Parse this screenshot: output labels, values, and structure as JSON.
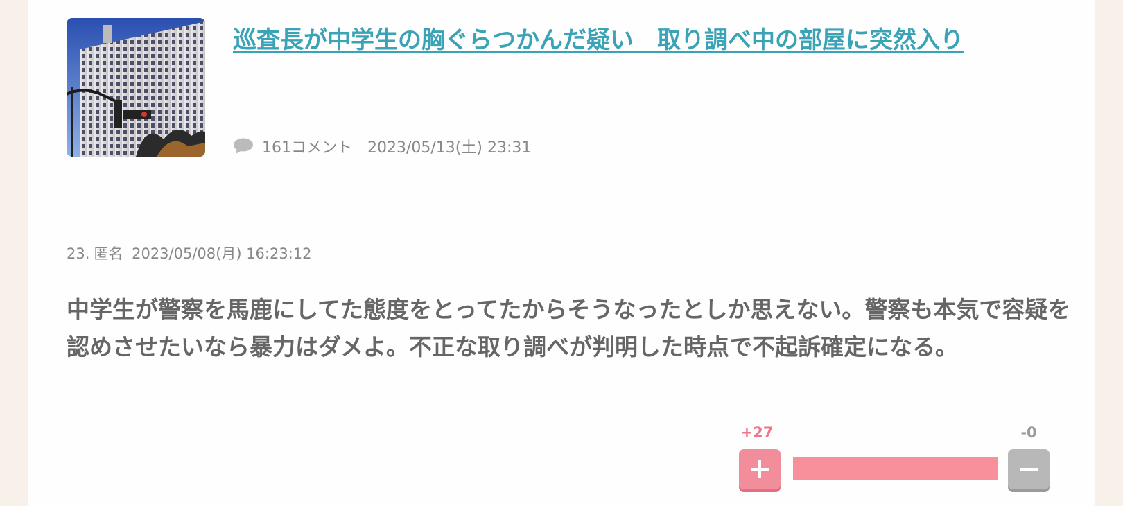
{
  "article": {
    "title": "巡査長が中学生の胸ぐらつかんだ疑い　取り調べ中の部屋に突然入り",
    "comment_icon": "speech-bubble-icon",
    "comment_count": "161コメント",
    "date": "2023/05/13(土) 23:31"
  },
  "comment": {
    "number": "23.",
    "author": "匿名",
    "timestamp": "2023/05/08(月) 16:23:12",
    "body": "中学生が警察を馬鹿にしてた態度をとってたからそうなったとしか思えない。警察も本気で容疑を認めさせたいなら暴力はダメよ。不正な取り調べが判明した時点で不起訴確定になる。",
    "vote": {
      "plus_label": "+27",
      "minus_label": "-0",
      "plus_share": 1.0,
      "plus_icon": "plus-icon",
      "minus_icon": "minus-icon"
    }
  },
  "colors": {
    "title_link": "#3aa3b5",
    "plus": "#f28d9b",
    "minus": "#b8b8b8",
    "background": "#f8f1ea"
  }
}
